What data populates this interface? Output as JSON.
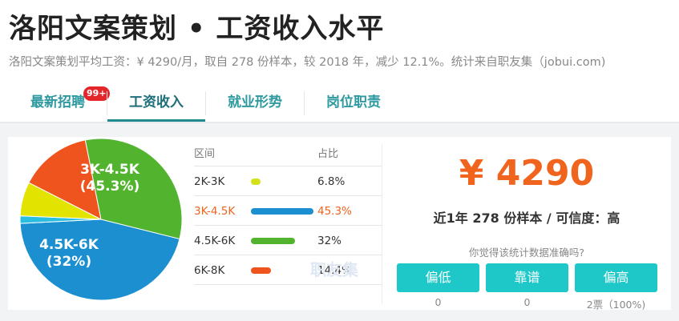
{
  "header": {
    "title": "洛阳文案策划 • 工资收入水平",
    "subtitle": "洛阳文案策划平均工资：¥ 4290/月，取自 278 份样本，较 2018 年，减少 12.1%。统计来自职友集（jobui.com)"
  },
  "tabs": [
    {
      "label": "最新招聘",
      "badge": "99+"
    },
    {
      "label": "工资收入"
    },
    {
      "label": "就业形势"
    },
    {
      "label": "岗位职责"
    }
  ],
  "distribution": {
    "col_range": "区间",
    "col_share": "占比",
    "rows": [
      {
        "range": "2K-3K",
        "pct": "6.8%",
        "value": 6.8,
        "color": "#d4e11a"
      },
      {
        "range": "3K-4.5K",
        "pct": "45.3%",
        "value": 45.3,
        "color": "#1b8fcf",
        "highlight": true
      },
      {
        "range": "4.5K-6K",
        "pct": "32%",
        "value": 32,
        "color": "#52b42e"
      },
      {
        "range": "6K-8K",
        "pct": "14.4%",
        "value": 14.4,
        "color": "#f0541e"
      }
    ],
    "watermark": "职友集"
  },
  "chart_data": {
    "type": "pie",
    "categories": [
      "3K-4.5K",
      "(unlabeled sliver)",
      "2K-3K",
      "6K-8K",
      "4.5K-6K"
    ],
    "values": [
      45.3,
      1.5,
      6.8,
      14.4,
      32
    ],
    "colors": [
      "#1b8fcf",
      "#29bde0",
      "#e3e300",
      "#f0541e",
      "#52b42e"
    ],
    "labels": [
      {
        "line1": "3K-4.5K",
        "line2": "(45.3%)"
      },
      {
        "line1": "4.5K-6K",
        "line2": "(32%)"
      }
    ]
  },
  "summary": {
    "average": "¥ 4290",
    "meta": "近1年 278 份样本 / 可信度：高",
    "question": "你觉得该统计数据准确吗?",
    "buttons": [
      {
        "label": "偏低",
        "count": "0"
      },
      {
        "label": "靠谱",
        "count": "0"
      },
      {
        "label": "偏高",
        "count": "2票（100%)"
      }
    ]
  }
}
